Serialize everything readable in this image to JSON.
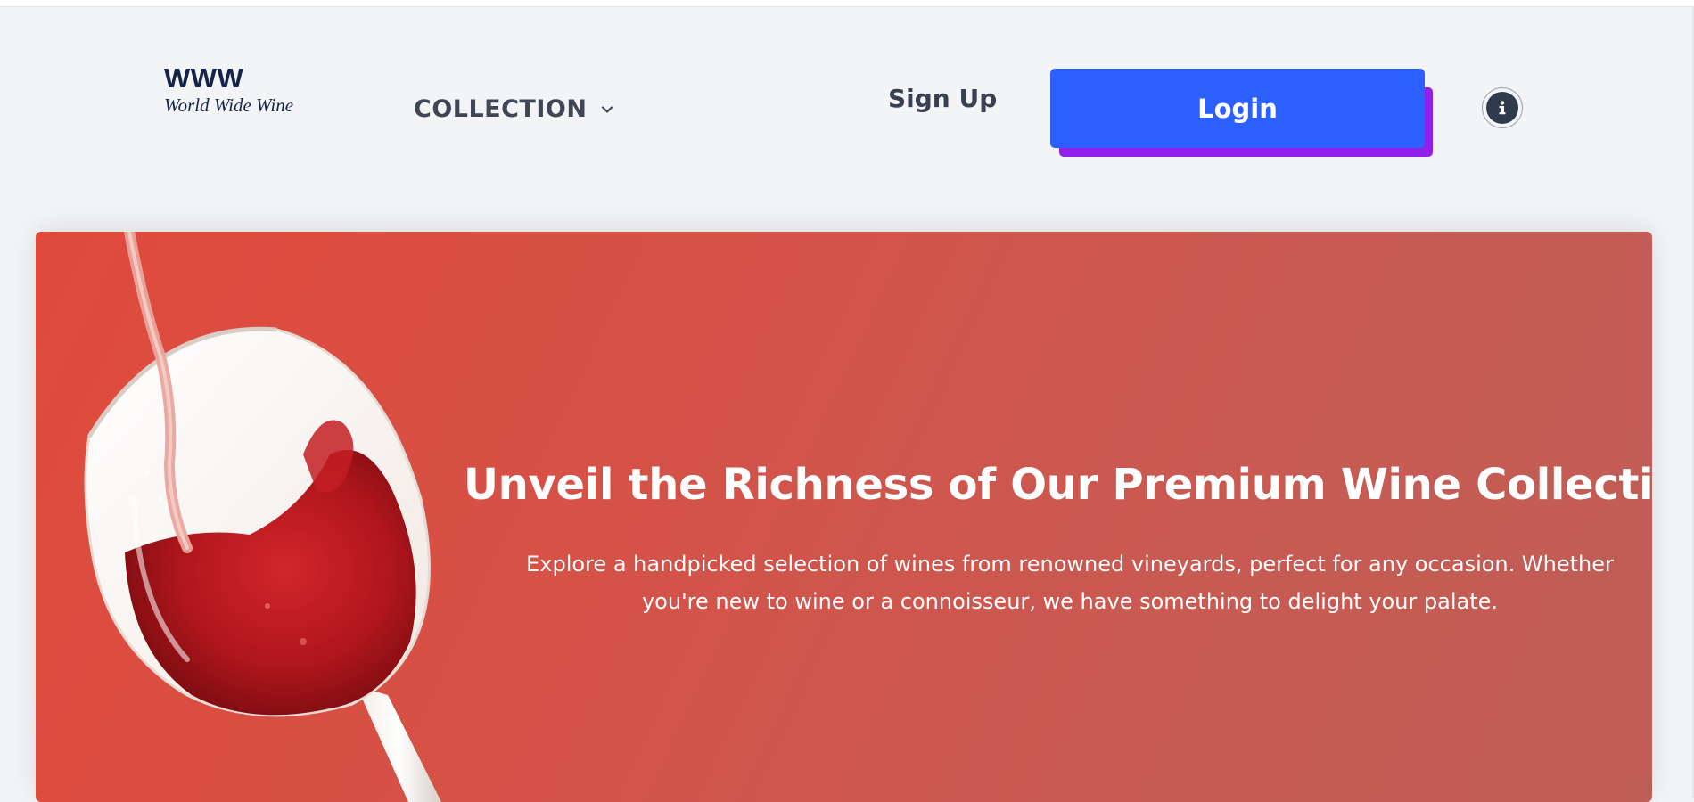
{
  "header": {
    "logo_mark": "WWW",
    "logo_tagline": "World Wide Wine",
    "nav": {
      "collection_label": "COLLECTION"
    },
    "signup_label": "Sign Up",
    "login_label": "Login",
    "info_icon_glyph": "i"
  },
  "hero": {
    "title": "Unveil the Richness of Our Premium Wine Collection",
    "subtitle": "Explore a handpicked selection of wines from renowned vineyards, perfect for any occasion. Whether you're new to wine or a connoisseur, we have something to delight your palate."
  },
  "icons": {
    "dropdown": "chevron-down-icon",
    "info": "info-icon",
    "hero_image": "wine-glass-pour-image"
  },
  "colors": {
    "brand": "#152349",
    "login_button": "#2b5fff",
    "login_button_shadow": "#9320ea",
    "hero_background": "#d9514a",
    "page_background": "#f3f4f6"
  }
}
